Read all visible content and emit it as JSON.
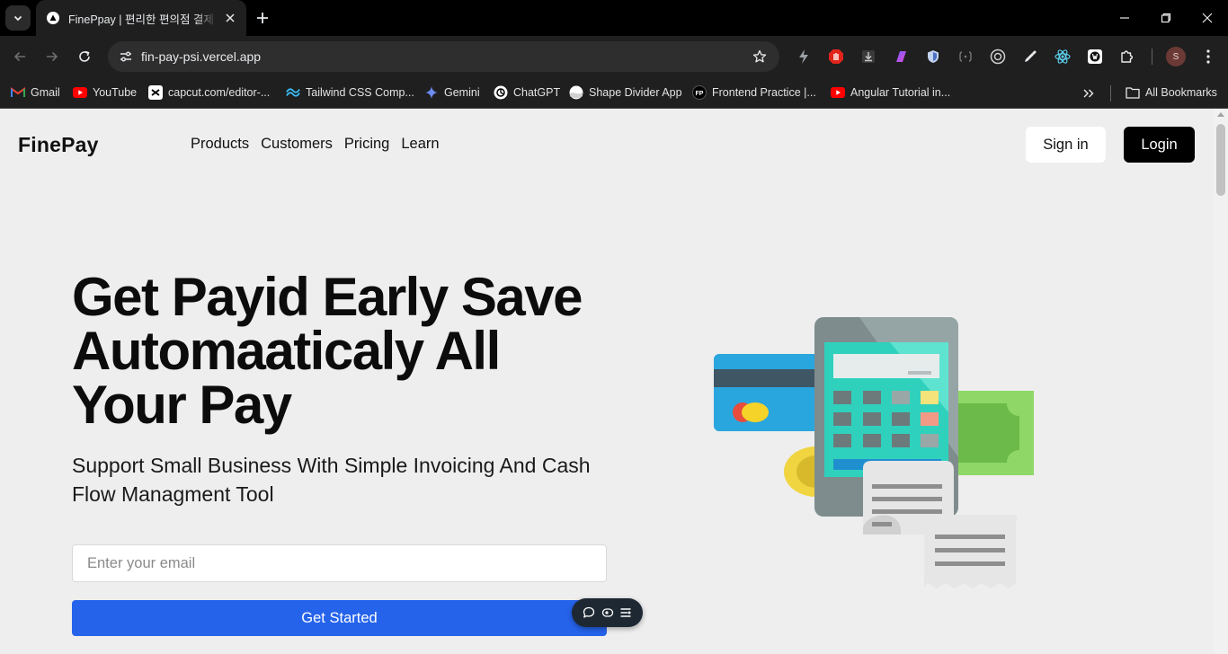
{
  "browser": {
    "tab_title": "FinePpay | 편리한 편의점 결제 서비스",
    "url": "fin-pay-psi.vercel.app",
    "profile_initial": "S",
    "icons": [
      "tab-search-icon",
      "vercel-icon",
      "close-icon",
      "plus-icon",
      "minimize-icon",
      "restore-icon",
      "close-icon",
      "back-arrow-icon",
      "forward-arrow-icon",
      "reload-icon",
      "site-settings-icon",
      "star-icon",
      "kebab-menu-icon"
    ],
    "extensions": [
      "bolt-icon",
      "stop-hand-icon",
      "download-icon",
      "gradient-icon",
      "shield-icon",
      "bracket-icon",
      "target-icon",
      "eyedropper-icon",
      "react-icon",
      "wappalyzer-icon",
      "puzzle-icon"
    ]
  },
  "bookmarks": {
    "items": [
      {
        "label": "Gmail",
        "icon": "gmail-icon"
      },
      {
        "label": "YouTube",
        "icon": "youtube-icon"
      },
      {
        "label": "capcut.com/editor-...",
        "icon": "capcut-icon"
      },
      {
        "label": "Tailwind CSS Comp...",
        "icon": "tailwind-icon"
      },
      {
        "label": "Gemini",
        "icon": "gemini-icon"
      },
      {
        "label": "ChatGPT",
        "icon": "chatgpt-icon"
      },
      {
        "label": "Shape Divider App",
        "icon": "shape-divider-icon"
      },
      {
        "label": "Frontend Practice |...",
        "icon": "fp-icon"
      },
      {
        "label": "Angular Tutorial in...",
        "icon": "youtube-icon"
      }
    ],
    "all_bookmarks": "All Bookmarks"
  },
  "site": {
    "brand": "FinePay",
    "nav": [
      "Products",
      "Customers",
      "Pricing",
      "Learn"
    ],
    "sign_in": "Sign in",
    "login": "Login",
    "hero_title": "Get Payid Early Save Automaaticaly All Your Pay",
    "hero_subtitle": "Support Small Business With Simple Invoicing And Cash Flow Managment Tool",
    "email_placeholder": "Enter your email",
    "cta": "Get Started",
    "illustration": "payment-terminal-illustration"
  },
  "colors": {
    "cta_blue": "#2563eb",
    "login_black": "#000000",
    "page_bg": "#eeeeee",
    "chrome_dark": "#1f1f1f"
  }
}
